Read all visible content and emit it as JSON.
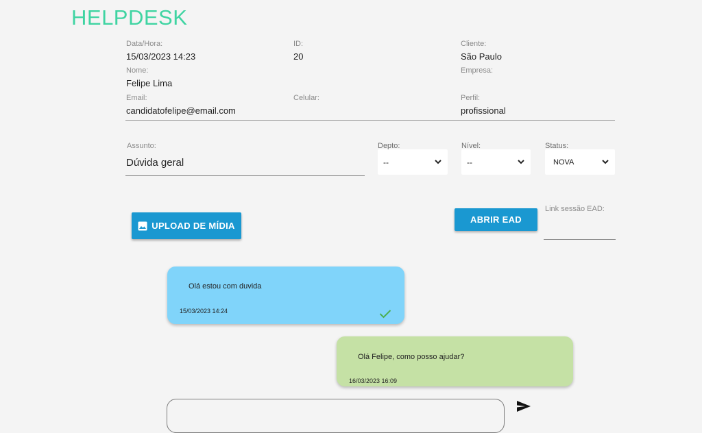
{
  "app": {
    "title": "HELPDESK"
  },
  "info": {
    "datahora": {
      "label": "Data/Hora:",
      "value": "15/03/2023 14:23"
    },
    "id": {
      "label": "ID:",
      "value": "20"
    },
    "cliente": {
      "label": "Cliente:",
      "value": "São Paulo"
    },
    "nome": {
      "label": "Nome:",
      "value": "Felipe Lima"
    },
    "empresa": {
      "label": "Empresa:",
      "value": ""
    },
    "email": {
      "label": "Email:",
      "value": "candidatofelipe@email.com"
    },
    "celular": {
      "label": "Celular:",
      "value": ""
    },
    "perfil": {
      "label": "Perfil:",
      "value": "profissional"
    }
  },
  "form": {
    "assunto": {
      "label": "Assunto:",
      "value": "Dúvida geral"
    },
    "depto": {
      "label": "Depto:",
      "value": "--"
    },
    "nivel": {
      "label": "Nível:",
      "value": "--"
    },
    "status": {
      "label": "Status:",
      "value": "NOVA"
    }
  },
  "actions": {
    "upload_label": "UPLOAD DE MÍDIA",
    "abrir_label": "ABRIR EAD",
    "link_label": "Link sessão EAD:",
    "link_value": ""
  },
  "messages": [
    {
      "text": "Olá estou com duvida",
      "time": "15/03/2023 14:24",
      "color": "#80d4fa",
      "read": true
    },
    {
      "text": "Olá Felipe, como posso ajudar?",
      "time": "16/03/2023 16:09",
      "color": "#c5e1a5",
      "read": false
    }
  ],
  "composer": {
    "placeholder": ""
  },
  "colors": {
    "accent": "#1a98d1",
    "title": "#3fd4a2",
    "check": "#4caf50"
  },
  "icons": {
    "upload": "image-icon",
    "check": "check-icon",
    "send": "send-icon",
    "select": "chevron-down-icon"
  }
}
